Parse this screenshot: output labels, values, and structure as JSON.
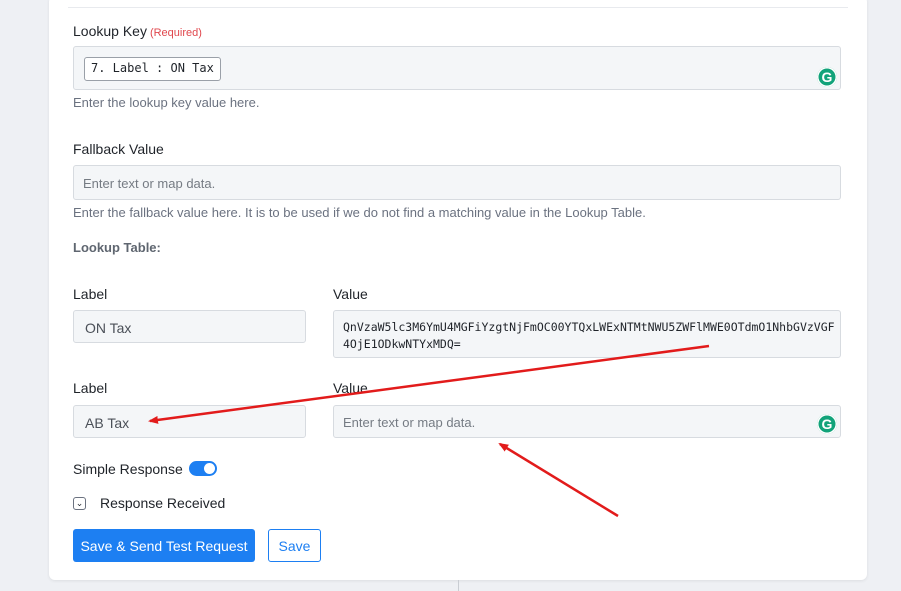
{
  "lookup_key": {
    "label": "Lookup Key",
    "required": "(Required)",
    "chip": "7. Label : ON Tax",
    "helper": "Enter the lookup key value here."
  },
  "fallback": {
    "label": "Fallback Value",
    "placeholder": "Enter text or map data.",
    "helper": "Enter the fallback value here. It is to be used if we do not find a matching value in the Lookup Table."
  },
  "lookup_table": {
    "title": "Lookup Table:",
    "rows": [
      {
        "label_header": "Label",
        "value_header": "Value",
        "label": "ON Tax",
        "value": "QnVzaW5lc3M6YmU4MGFiYzgtNjFmOC00YTQxLWExNTMtNWU5ZWFlMWE0OTdmO1NhbGVzVGF4OjE1ODkwNTYxMDQ="
      },
      {
        "label_header": "Label",
        "value_header": "Value",
        "label": "AB Tax",
        "value_placeholder": "Enter text or map data."
      }
    ]
  },
  "simple_response": {
    "label": "Simple Response",
    "enabled": true
  },
  "response_received": {
    "label": "Response Received"
  },
  "buttons": {
    "send_test": "Save & Send Test Request",
    "save": "Save"
  },
  "icons": {
    "grammarly": "grammarly-icon",
    "chevron": "chevron-down-icon"
  },
  "colors": {
    "accent": "#1d7ff2",
    "required": "#e0474d",
    "arrow": "#e21b1b",
    "grammarly": "#12a37a"
  }
}
